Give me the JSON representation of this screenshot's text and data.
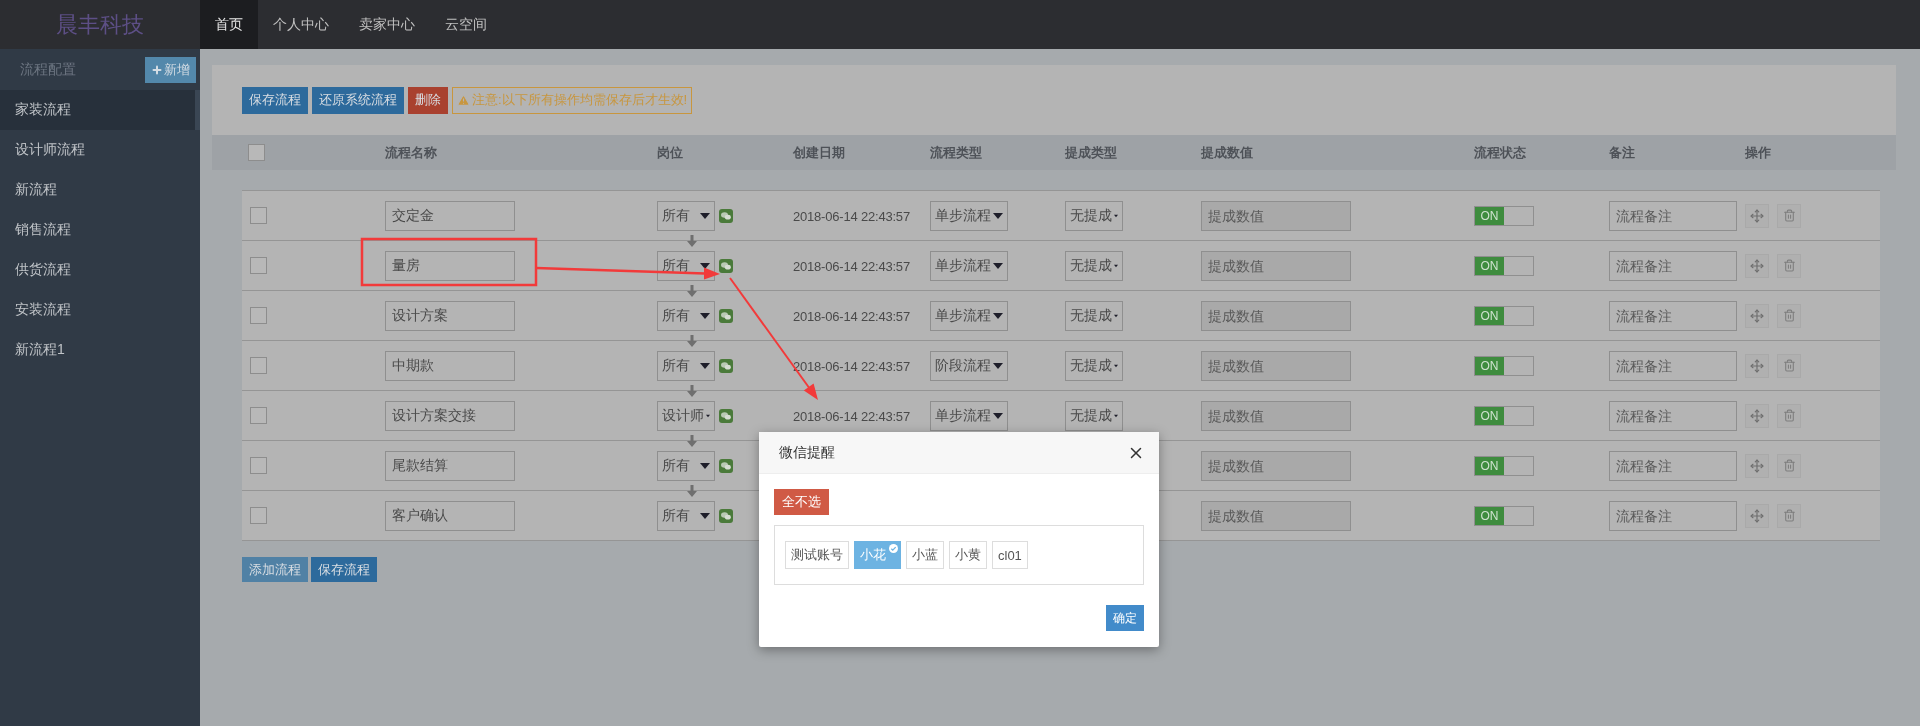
{
  "brand": "晨丰科技",
  "nav": [
    {
      "label": "首页",
      "selected": true
    },
    {
      "label": "个人中心",
      "selected": false
    },
    {
      "label": "卖家中心",
      "selected": false
    },
    {
      "label": "云空间",
      "selected": false
    }
  ],
  "sidebar": {
    "title": "流程配置",
    "add_button": "新增",
    "items": [
      {
        "label": "家装流程",
        "selected": true
      },
      {
        "label": "设计师流程",
        "selected": false
      },
      {
        "label": "新流程",
        "selected": false
      },
      {
        "label": "销售流程",
        "selected": false
      },
      {
        "label": "供货流程",
        "selected": false
      },
      {
        "label": "安装流程",
        "selected": false
      },
      {
        "label": "新流程1",
        "selected": false
      }
    ]
  },
  "toolbar": {
    "buttons": [
      {
        "label": "保存流程",
        "kind": "primary"
      },
      {
        "label": "还原系统流程",
        "kind": "primary"
      },
      {
        "label": "删除",
        "kind": "danger"
      }
    ],
    "notice": "注意:以下所有操作均需保存后才生效!"
  },
  "table": {
    "header_checked": false,
    "columns": [
      "流程名称",
      "岗位",
      "创建日期",
      "流程类型",
      "提成类型",
      "提成数值",
      "流程状态",
      "备注",
      "操作"
    ],
    "rows": [
      {
        "checked": false,
        "name": "交定金",
        "post": "所有",
        "date": "2018-06-14 22:43:57",
        "flow_type": "单步流程",
        "commission_type": "无提成",
        "commission_placeholder": "提成数值",
        "status_on": true,
        "status_label": "ON",
        "remark_placeholder": "流程备注"
      },
      {
        "checked": false,
        "name": "量房",
        "post": "所有",
        "date": "2018-06-14 22:43:57",
        "flow_type": "单步流程",
        "commission_type": "无提成",
        "commission_placeholder": "提成数值",
        "status_on": true,
        "status_label": "ON",
        "remark_placeholder": "流程备注"
      },
      {
        "checked": false,
        "name": "设计方案",
        "post": "所有",
        "date": "2018-06-14 22:43:57",
        "flow_type": "单步流程",
        "commission_type": "无提成",
        "commission_placeholder": "提成数值",
        "status_on": true,
        "status_label": "ON",
        "remark_placeholder": "流程备注"
      },
      {
        "checked": false,
        "name": "中期款",
        "post": "所有",
        "date": "2018-06-14 22:43:57",
        "flow_type": "阶段流程",
        "commission_type": "无提成",
        "commission_placeholder": "提成数值",
        "status_on": true,
        "status_label": "ON",
        "remark_placeholder": "流程备注"
      },
      {
        "checked": false,
        "name": "设计方案交接",
        "post": "设计师",
        "date": "2018-06-14 22:43:57",
        "flow_type": "单步流程",
        "commission_type": "无提成",
        "commission_placeholder": "提成数值",
        "status_on": true,
        "status_label": "ON",
        "remark_placeholder": "流程备注"
      },
      {
        "checked": false,
        "name": "尾款结算",
        "post": "所有",
        "commission_placeholder": "提成数值",
        "status_on": true,
        "status_label": "ON",
        "remark_placeholder": "流程备注"
      },
      {
        "checked": false,
        "name": "客户确认",
        "post": "所有",
        "commission_placeholder": "提成数值",
        "status_on": true,
        "status_label": "ON",
        "remark_placeholder": "流程备注"
      }
    ]
  },
  "footer_buttons": [
    {
      "label": "添加流程",
      "kind": "light"
    },
    {
      "label": "保存流程",
      "kind": "primary"
    }
  ],
  "modal": {
    "title": "微信提醒",
    "clear_button": "全不选",
    "users": [
      {
        "label": "测试账号",
        "selected": false
      },
      {
        "label": "小花",
        "selected": true
      },
      {
        "label": "小蓝",
        "selected": false
      },
      {
        "label": "小黄",
        "selected": false
      },
      {
        "label": "cl01",
        "selected": false
      }
    ],
    "confirm": "确定"
  }
}
